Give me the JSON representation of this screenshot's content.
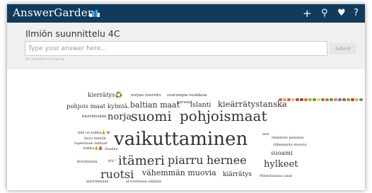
{
  "app": {
    "brand": "AnswerGarden",
    "nav": {
      "add_icon": "plus-icon",
      "search_icon": "search-icon",
      "heart_icon": "heart-icon",
      "help_icon": "question-icon",
      "add_glyph": "+",
      "search_glyph": "⚲",
      "heart_glyph": "♥",
      "help_glyph": "?"
    },
    "colors": {
      "topbar": "#113b5c",
      "background": "#f0f0f0",
      "cloud_background": "#ffffff"
    }
  },
  "question": {
    "title": "Ilmiön suunnittelu 4C",
    "placeholder": "Type your answer here...",
    "submit_label": "Submit",
    "remaining": "20 characters remaining"
  },
  "cloud": {
    "words": [
      {
        "text": "kierrätys♻️"
      },
      {
        "text": "norjan vuoristo"
      },
      {
        "text": "suurempia roskiksia"
      },
      {
        "text": "pohjois maat kylmiä."
      },
      {
        "text": "baltian maat"
      },
      {
        "text": "perunat"
      },
      {
        "text": "islanti"
      },
      {
        "text": "kieärrätystanska"
      },
      {
        "text": "kierrätetään"
      },
      {
        "text": "norja"
      },
      {
        "text": "suomi"
      },
      {
        "text": "pohjoismaat"
      },
      {
        "text": "lidä on kakka⚠️👾"
      },
      {
        "text": "havu metsät"
      },
      {
        "text": "lopetetaan tehtaat"
      },
      {
        "text": "kakka⚠️💩"
      },
      {
        "text": "ötaaliis"
      },
      {
        "text": "vaikuttaminen"
      },
      {
        "text": "moi"
      },
      {
        "text": "itämeren pelastus"
      },
      {
        "text": "vähemmän muovia"
      },
      {
        "text": "suoami"
      },
      {
        "text": "kirrätetään"
      },
      {
        "text": "$%^"
      },
      {
        "text": "itämeri"
      },
      {
        "text": "piarru"
      },
      {
        "text": "hernee"
      },
      {
        "text": "hylkeet"
      },
      {
        "text": "ruotsi"
      },
      {
        "text": "vähemmän muovia"
      },
      {
        "text": "kiärrätys"
      },
      {
        "text": "fitlandiaaaaa aaaa"
      },
      {
        "text": "kiärrätetään"
      },
      {
        "text": "arvostetaan eläimiä"
      }
    ]
  }
}
